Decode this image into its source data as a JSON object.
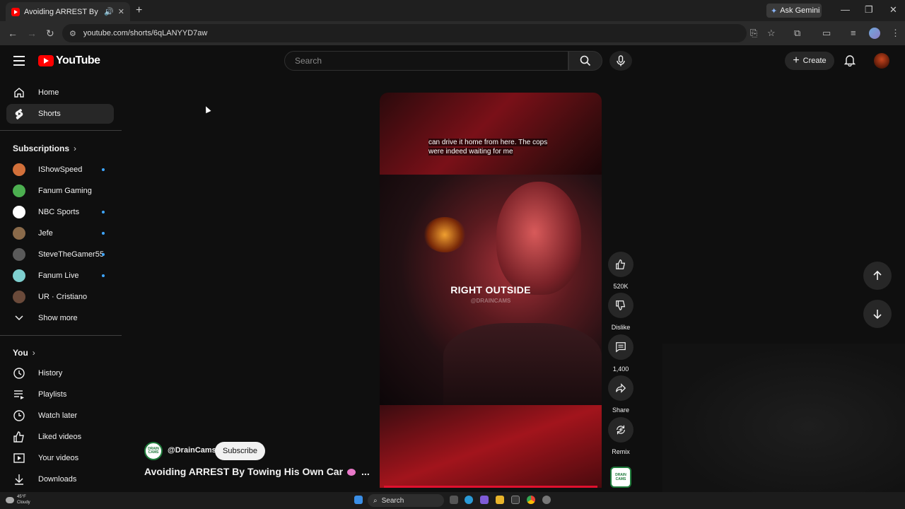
{
  "browser": {
    "tab_title": "Avoiding ARREST By Towing",
    "url": "youtube.com/shorts/6qLANYYD7aw",
    "gemini_label": "Ask Gemini"
  },
  "header": {
    "logo_text": "YouTube",
    "search_placeholder": "Search",
    "create_label": "Create"
  },
  "sidebar": {
    "main": [
      {
        "label": "Home",
        "icon": "home-icon"
      },
      {
        "label": "Shorts",
        "icon": "shorts-icon",
        "active": true
      }
    ],
    "subscriptions_heading": "Subscriptions",
    "subscriptions": [
      {
        "label": "IShowSpeed",
        "new": true,
        "color": "#d2703a"
      },
      {
        "label": "Fanum Gaming",
        "new": false,
        "color": "#4caf50"
      },
      {
        "label": "NBC Sports",
        "new": true,
        "color": "#ffffff"
      },
      {
        "label": "Jefe",
        "new": true,
        "color": "#8a6a4a"
      },
      {
        "label": "SteveTheGamer55",
        "new": true,
        "color": "#5a5a5a"
      },
      {
        "label": "Fanum Live",
        "new": true,
        "color": "#7ecfcf"
      },
      {
        "label": "UR · Cristiano",
        "new": false,
        "color": "#6a4a3a"
      }
    ],
    "show_more": "Show more",
    "you_heading": "You",
    "you_items": [
      {
        "label": "History",
        "icon": "history-icon"
      },
      {
        "label": "Playlists",
        "icon": "playlists-icon"
      },
      {
        "label": "Watch later",
        "icon": "watch-later-icon"
      },
      {
        "label": "Liked videos",
        "icon": "liked-icon"
      },
      {
        "label": "Your videos",
        "icon": "your-videos-icon"
      },
      {
        "label": "Downloads",
        "icon": "downloads-icon"
      }
    ]
  },
  "video": {
    "caption": "can drive it home from here. The cops were indeed waiting for me",
    "overlay_text": "RIGHT OUTSIDE",
    "watermark": "@DRAINCAMS",
    "channel": "@DrainCams",
    "channel_avatar_text": "DRAIN CAMS",
    "subscribe_label": "Subscribe",
    "title": "Avoiding ARREST By Towing His Own Car",
    "title_more": "..."
  },
  "actions": {
    "likes": "520K",
    "dislike": "Dislike",
    "comments": "1,400",
    "share": "Share",
    "remix": "Remix"
  },
  "taskbar": {
    "temp": "45°F",
    "weather": "Cloudy",
    "search": "Search"
  }
}
